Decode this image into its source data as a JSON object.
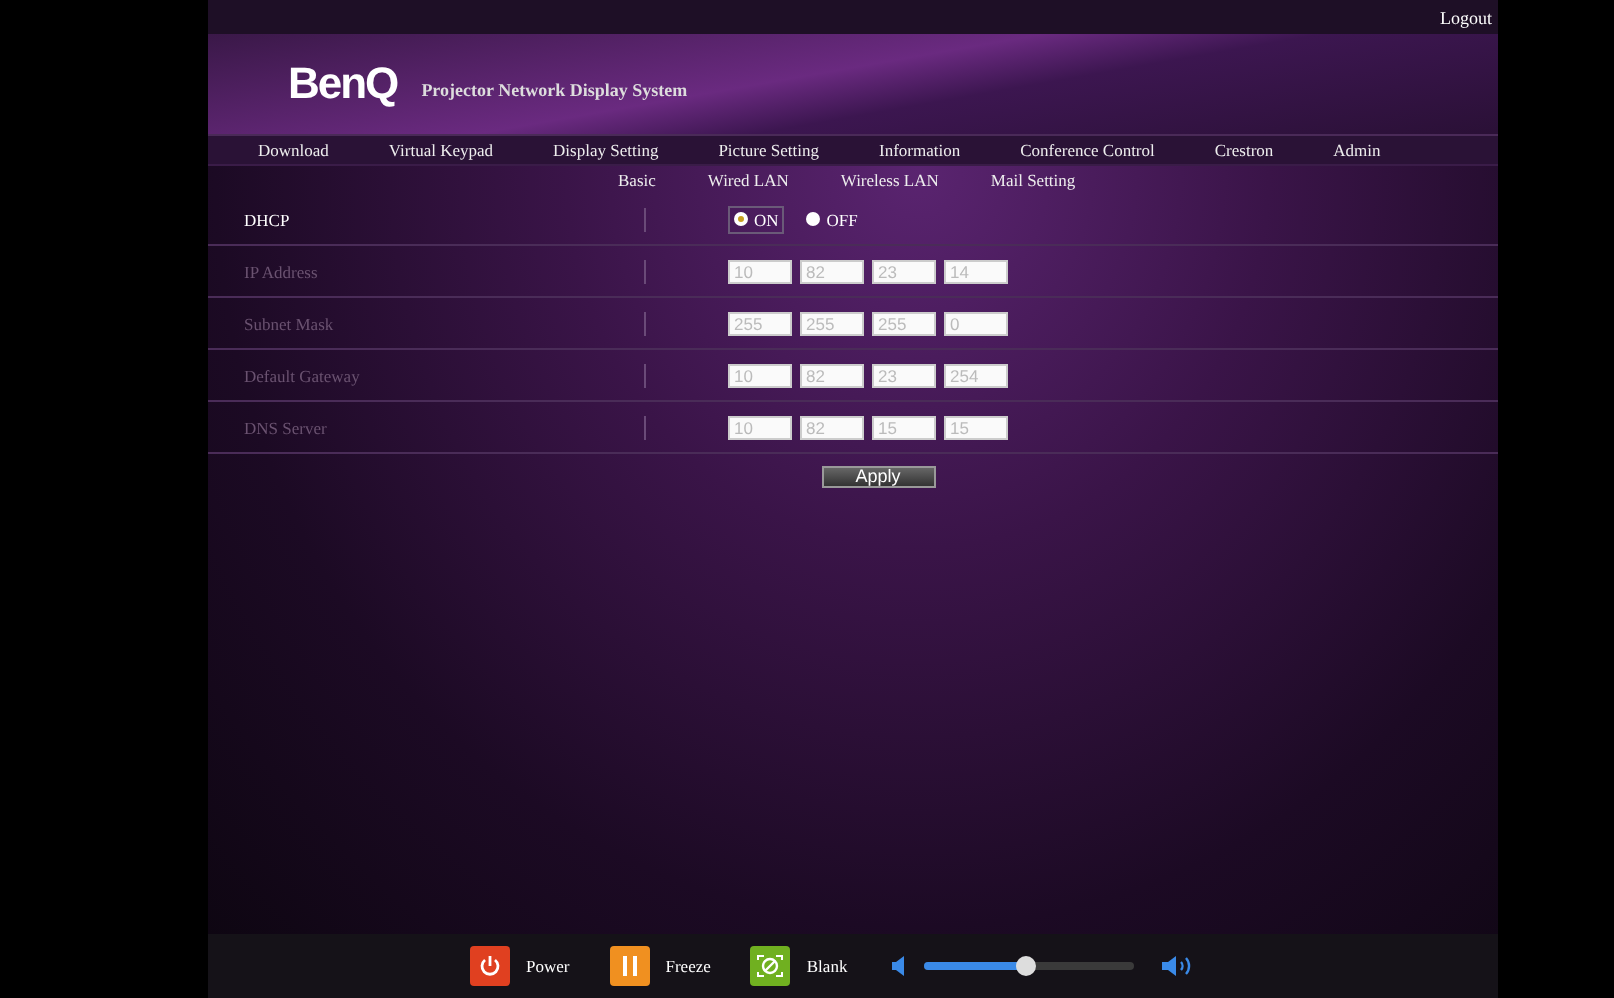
{
  "top_bar": {
    "logout": "Logout"
  },
  "header": {
    "logo": "BenQ",
    "title": "Projector Network Display System"
  },
  "nav": [
    "Download",
    "Virtual Keypad",
    "Display Setting",
    "Picture Setting",
    "Information",
    "Conference Control",
    "Crestron",
    "Admin"
  ],
  "subnav": [
    "Basic",
    "Wired LAN",
    "Wireless LAN",
    "Mail Setting"
  ],
  "dhcp": {
    "label": "DHCP",
    "options": [
      {
        "label": "ON",
        "selected": true
      },
      {
        "label": "OFF",
        "selected": false
      }
    ]
  },
  "fields": [
    {
      "label": "IP Address",
      "disabled": true,
      "octets": [
        "10",
        "82",
        "23",
        "14"
      ]
    },
    {
      "label": "Subnet Mask",
      "disabled": true,
      "octets": [
        "255",
        "255",
        "255",
        "0"
      ]
    },
    {
      "label": "Default Gateway",
      "disabled": true,
      "octets": [
        "10",
        "82",
        "23",
        "254"
      ]
    },
    {
      "label": "DNS Server",
      "disabled": true,
      "octets": [
        "10",
        "82",
        "15",
        "15"
      ]
    }
  ],
  "apply": "Apply",
  "footer": {
    "buttons": [
      {
        "kind": "power",
        "label": "Power"
      },
      {
        "kind": "freeze",
        "label": "Freeze"
      },
      {
        "kind": "blank",
        "label": "Blank"
      }
    ],
    "volume": {
      "level": 0.49
    }
  }
}
